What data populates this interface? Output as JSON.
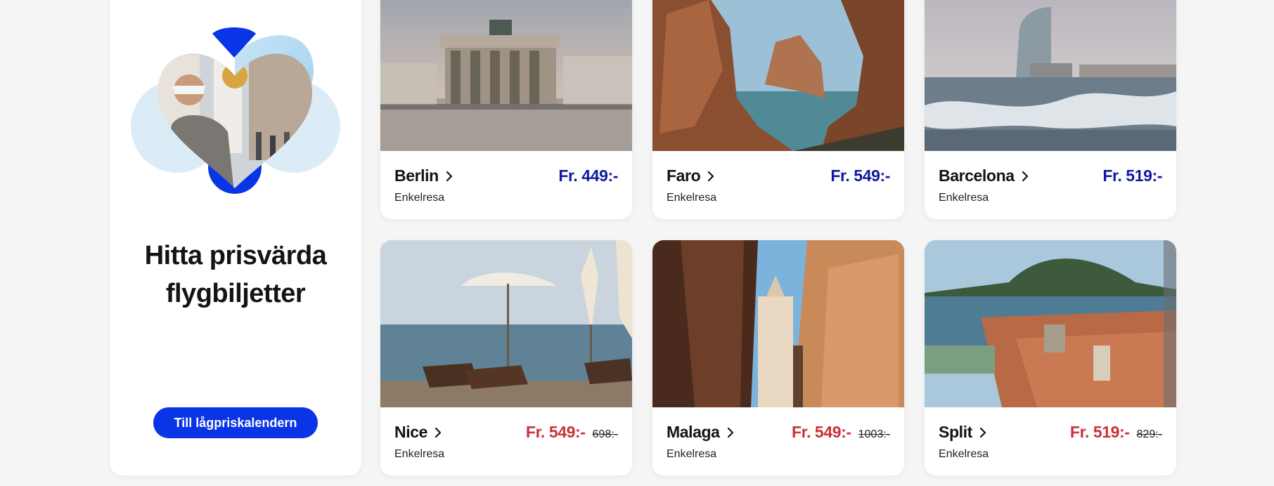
{
  "promo": {
    "title_line1": "Hitta prisvärda",
    "title_line2": "flygbiljetter",
    "cta_label": "Till lågpriskalendern"
  },
  "colors": {
    "brand_blue": "#0a35e6",
    "price_blue": "#0e1a9c",
    "sale_red": "#c8323a"
  },
  "destinations": [
    {
      "city": "Berlin",
      "price": "Fr. 449:-",
      "old_price": "",
      "trip": "Enkelresa"
    },
    {
      "city": "Faro",
      "price": "Fr. 549:-",
      "old_price": "",
      "trip": "Enkelresa"
    },
    {
      "city": "Barcelona",
      "price": "Fr. 519:-",
      "old_price": "",
      "trip": "Enkelresa"
    },
    {
      "city": "Nice",
      "price": "Fr. 549:-",
      "old_price": "698:-",
      "trip": "Enkelresa"
    },
    {
      "city": "Malaga",
      "price": "Fr. 549:-",
      "old_price": "1003:-",
      "trip": "Enkelresa"
    },
    {
      "city": "Split",
      "price": "Fr. 519:-",
      "old_price": "829:-",
      "trip": "Enkelresa"
    }
  ]
}
